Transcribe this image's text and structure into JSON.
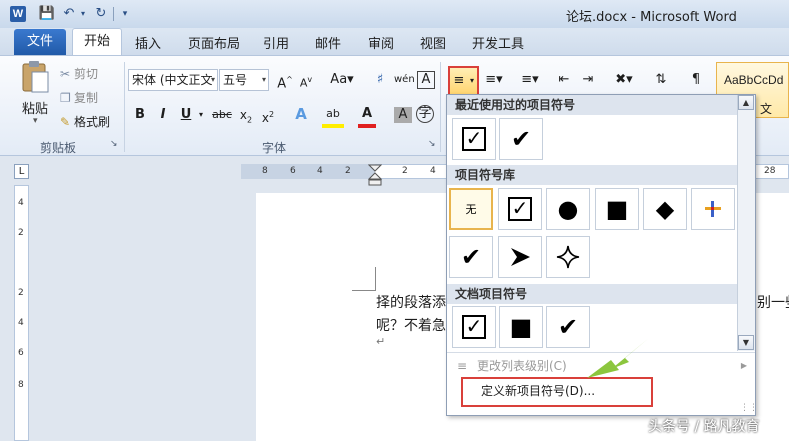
{
  "window": {
    "title": "论坛.docx - Microsoft Word",
    "app_icon_letter": "W"
  },
  "tabs": {
    "file": "文件",
    "items": [
      "开始",
      "插入",
      "页面布局",
      "引用",
      "邮件",
      "审阅",
      "视图",
      "开发工具"
    ],
    "active": "开始"
  },
  "clipboard": {
    "paste": "粘贴",
    "cut": "剪切",
    "copy": "复制",
    "format_painter": "格式刷",
    "group_label": "剪贴板"
  },
  "font": {
    "name": "宋体 (中文正文",
    "size": "五号",
    "group_label": "字体"
  },
  "styles": {
    "preview": "AaBbCcDd",
    "sub": "文"
  },
  "gallery": {
    "recent_header": "最近使用过的项目符号",
    "library_header": "项目符号库",
    "document_header": "文档项目符号",
    "none_label": "无",
    "change_level": "更改列表级别(C)",
    "define_new": "定义新项目符号(D)..."
  },
  "document": {
    "line1_start": "择的段落添",
    "line1_end": "别一些",
    "line2": "呢？不着急",
    "para_mark": "↵"
  },
  "ruler": {
    "h_marks": [
      "8",
      "6",
      "4",
      "2",
      "2",
      "4",
      "28"
    ],
    "v_marks": [
      "4",
      "2",
      "2",
      "4",
      "6",
      "8"
    ]
  },
  "watermark": "头条号 / 路凡教育",
  "colors": {
    "accent_blue": "#2a5ea8",
    "highlight_red": "#d9403a",
    "selection_gold": "#e8b44d",
    "arrow_green": "#8cc63e"
  }
}
